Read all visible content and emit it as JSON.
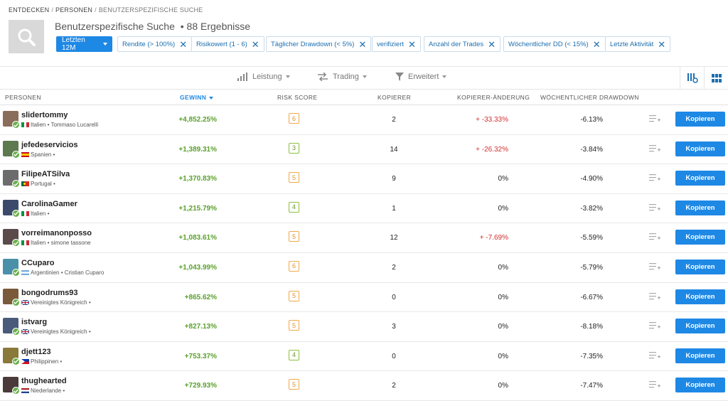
{
  "breadcrumb": [
    "ENTDECKEN",
    "PERSONEN",
    "BENUTZERSPEZIFISCHE SUCHE"
  ],
  "title": "Benutzerspezifische Suche",
  "result_count": "• 88 Ergebnisse",
  "period_button": "Letzten 12M",
  "filters": [
    "Rendite (> 100%)",
    "Risikowert (1 - 6)",
    "Täglicher Drawdown (< 5%)",
    "verifiziert",
    "Anzahl der Trades",
    "Wöchentlicher DD (< 15%)",
    "Letzte Aktivität"
  ],
  "toolbar": {
    "performance": "Leistung",
    "trading": "Trading",
    "advanced": "Erweitert"
  },
  "columns": {
    "people": "PERSONEN",
    "gain": "GEWINN",
    "risk": "RISK SCORE",
    "copiers": "KOPIERER",
    "copier_change": "KOPIERER-ÄNDERUNG",
    "weekly_dd": "WÖCHENTLICHER DRAWDOWN"
  },
  "copy_label": "Kopieren",
  "colors": {
    "accent": "#1e88e5",
    "positive": "#5aa02c",
    "negative": "#d32f2f",
    "risk_orange": "#e2922a",
    "risk_green": "#6b9a2a"
  },
  "rows": [
    {
      "name": "slidertommy",
      "meta": "Italien • Tommaso Lucarelli",
      "country_flag": "it",
      "gain": "+4,852.25%",
      "risk": "6",
      "copiers": "2",
      "change": "+ -33.33%",
      "change_negative": true,
      "dd": "-6.13%"
    },
    {
      "name": "jefedeservicios",
      "meta": "Spanien •",
      "country_flag": "es",
      "gain": "+1,389.31%",
      "risk": "3",
      "copiers": "14",
      "change": "+ -26.32%",
      "change_negative": true,
      "dd": "-3.84%"
    },
    {
      "name": "FilipeATSilva",
      "meta": "Portugal •",
      "country_flag": "pt",
      "gain": "+1,370.83%",
      "risk": "5",
      "copiers": "9",
      "change": "0%",
      "change_negative": false,
      "dd": "-4.90%"
    },
    {
      "name": "CarolinaGamer",
      "meta": "Italien •",
      "country_flag": "it",
      "gain": "+1,215.79%",
      "risk": "4",
      "copiers": "1",
      "change": "0%",
      "change_negative": false,
      "dd": "-3.82%"
    },
    {
      "name": "vorreimanonposso",
      "meta": "Italien • simone tassone",
      "country_flag": "it",
      "gain": "+1,083.61%",
      "risk": "5",
      "copiers": "12",
      "change": "+ -7.69%",
      "change_negative": true,
      "dd": "-5.59%"
    },
    {
      "name": "CCuparo",
      "meta": "Argentinien • Cristian Cuparo",
      "country_flag": "ar",
      "gain": "+1,043.99%",
      "risk": "6",
      "copiers": "2",
      "change": "0%",
      "change_negative": false,
      "dd": "-5.79%"
    },
    {
      "name": "bongodrums93",
      "meta": "Vereinigtes Königreich •",
      "country_flag": "gb",
      "gain": "+865.62%",
      "risk": "5",
      "copiers": "0",
      "change": "0%",
      "change_negative": false,
      "dd": "-6.67%"
    },
    {
      "name": "istvarg",
      "meta": "Vereinigtes Königreich •",
      "country_flag": "gb",
      "gain": "+827.13%",
      "risk": "5",
      "copiers": "3",
      "change": "0%",
      "change_negative": false,
      "dd": "-8.18%"
    },
    {
      "name": "djett123",
      "meta": "Philippinen •",
      "country_flag": "ph",
      "gain": "+753.37%",
      "risk": "4",
      "copiers": "0",
      "change": "0%",
      "change_negative": false,
      "dd": "-7.35%"
    },
    {
      "name": "thughearted",
      "meta": "Niederlande •",
      "country_flag": "nl",
      "gain": "+729.93%",
      "risk": "5",
      "copiers": "2",
      "change": "0%",
      "change_negative": false,
      "dd": "-7.47%"
    }
  ]
}
